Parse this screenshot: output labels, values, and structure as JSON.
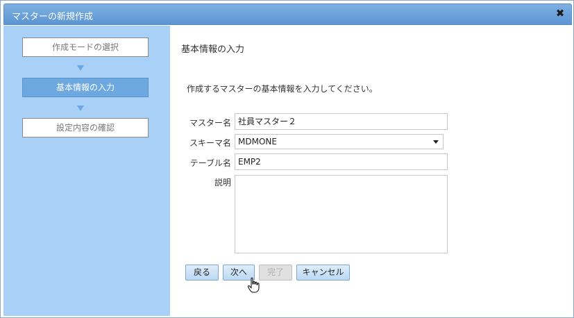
{
  "dialog": {
    "title": "マスターの新規作成",
    "close_icon": "close-icon"
  },
  "sidebar": {
    "steps": [
      {
        "label": "作成モードの選択",
        "active": false
      },
      {
        "label": "基本情報の入力",
        "active": true
      },
      {
        "label": "設定内容の確認",
        "active": false
      }
    ]
  },
  "main": {
    "section_title": "基本情報の入力",
    "description": "作成するマスターの基本情報を入力してください。",
    "fields": {
      "master_name": {
        "label": "マスター名",
        "value": "社員マスター２"
      },
      "schema_name": {
        "label": "スキーマ名",
        "value": "MDMONE"
      },
      "table_name": {
        "label": "テーブル名",
        "value": "EMP2"
      },
      "description": {
        "label": "説明",
        "value": ""
      }
    }
  },
  "buttons": {
    "back": "戻る",
    "next": "次へ",
    "finish": "完了",
    "cancel": "キャンセル"
  },
  "colors": {
    "titlebar": "#6ea4db",
    "sidebar": "#a9d1f7",
    "active_step": "#6da8e0",
    "button": "#cfe4f8"
  }
}
